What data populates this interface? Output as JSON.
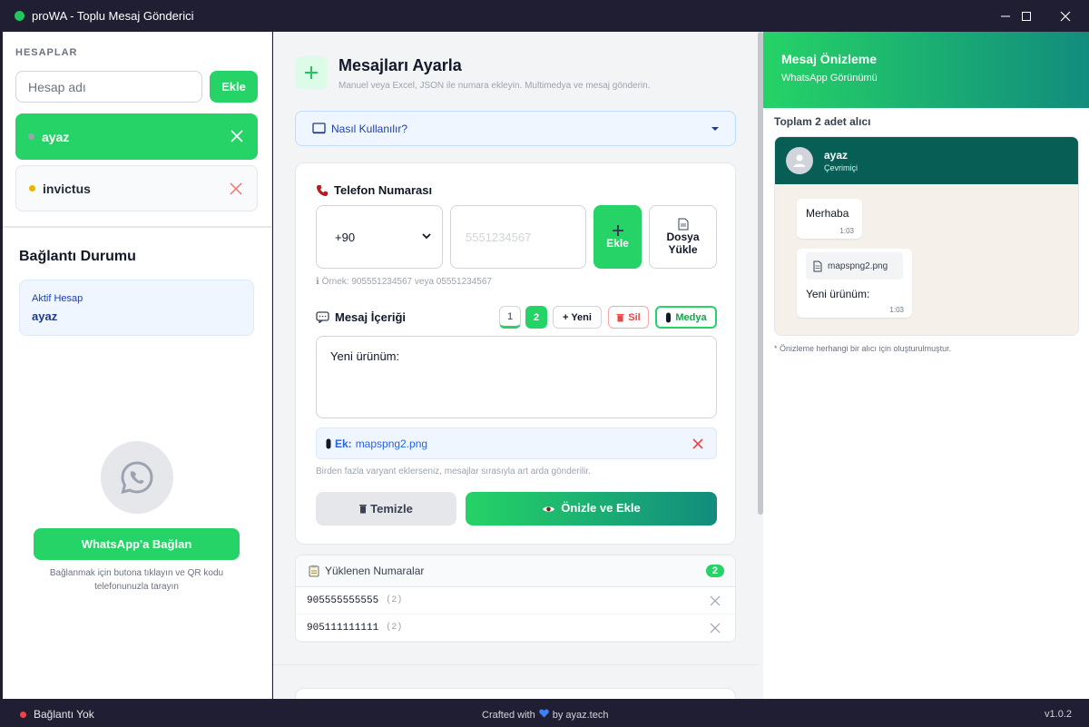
{
  "window": {
    "title": "proWA - Toplu Mesaj Gönderici"
  },
  "sidebar": {
    "section_label": "HESAPLAR",
    "account_input_placeholder": "Hesap adı",
    "add_button": "Ekle",
    "accounts": [
      {
        "name": "ayaz",
        "status_color": "#9ca3af",
        "active": true
      },
      {
        "name": "invictus",
        "status_color": "#eab308",
        "active": false
      }
    ],
    "connection_title": "Bağlantı Durumu",
    "active_account_label": "Aktif Hesap",
    "active_account_value": "ayaz",
    "connect_button": "WhatsApp'a Bağlan",
    "connect_hint": "Bağlanmak için butona tıklayın ve QR kodu telefonunuzla tarayın"
  },
  "main": {
    "title": "Mesajları Ayarla",
    "subtitle": "Manuel veya Excel, JSON ile numara ekleyin. Multimedya ve mesaj gönderin.",
    "howto_label": "Nasıl Kullanılır?",
    "phone_label": "Telefon Numarası",
    "country_code": "+90",
    "phone_placeholder": "5551234567",
    "add_button": "Ekle",
    "file_button_line1": "Dosya",
    "file_button_line2": "Yükle",
    "example_text": "ℹ Örnek: 905551234567 veya 05551234567",
    "message_label": "Mesaj İçeriği",
    "variant_1": "1",
    "variant_2": "2",
    "new_variant": "+ Yeni",
    "delete_variant": "Sil",
    "media_button": "Medya",
    "message_text": "Yeni ürünüm:",
    "attachment_label": "Ek:",
    "attachment_file": "mapspng2.png",
    "variant_hint": "Birden fazla varyant eklerseniz, mesajlar sırasıyla art arda gönderilir.",
    "clear_button": "Temizle",
    "preview_button": "Önizle ve Ekle",
    "numbers_title": "Yüklenen Numaralar",
    "numbers_count": "2",
    "numbers": [
      {
        "number": "905555555555",
        "count": "(2)"
      },
      {
        "number": "905111111111",
        "count": "(2)"
      }
    ]
  },
  "preview": {
    "title": "Mesaj Önizleme",
    "subtitle": "WhatsApp Görünümü",
    "total": "Toplam 2 adet alıcı",
    "contact_name": "ayaz",
    "contact_status": "Çevrimiçi",
    "bubble1_text": "Merhaba",
    "bubble1_time": "1:03",
    "bubble2_file": "mapspng2.png",
    "bubble2_text": "Yeni ürünüm:",
    "bubble2_time": "1:03",
    "note": "* Önizleme herhangi bir alıcı için oluşturulmuştur."
  },
  "footer": {
    "status": "Bağlantı Yok",
    "crafted_prefix": "Crafted with",
    "crafted_suffix": "by ayaz.tech",
    "version": "v1.0.2"
  },
  "colors": {
    "accent": "#25d366",
    "accent_dark": "#128c7e",
    "header": "#075e54",
    "titlebar": "#1f1e33"
  }
}
